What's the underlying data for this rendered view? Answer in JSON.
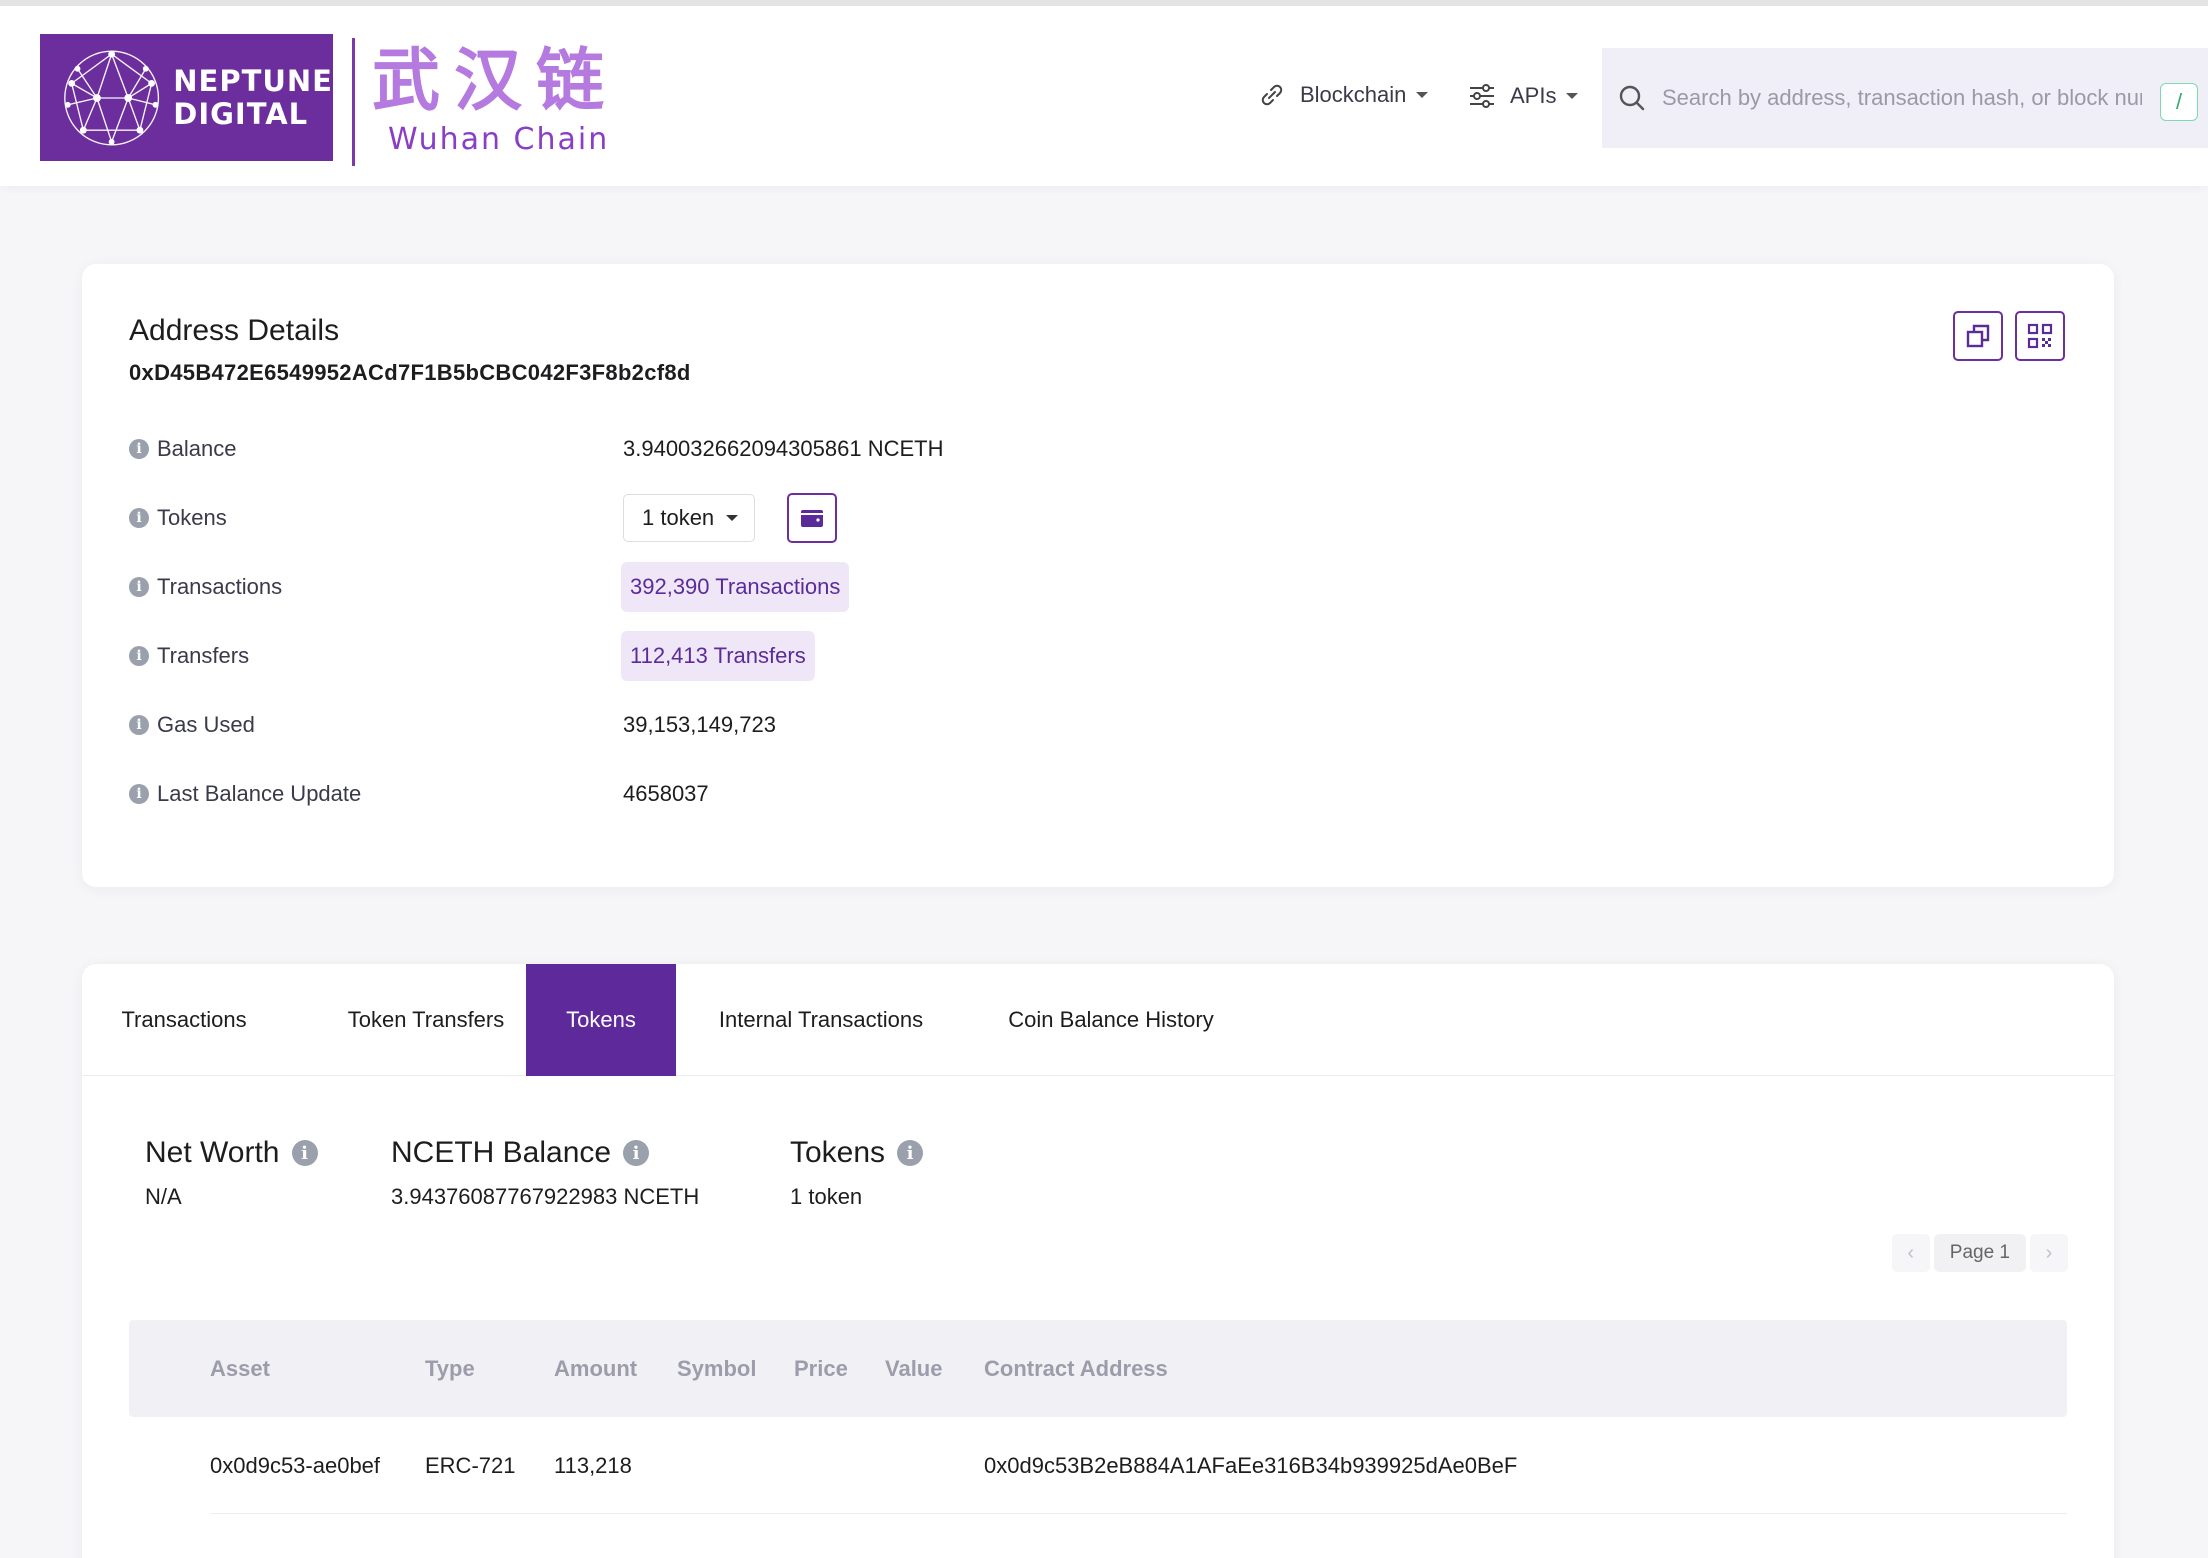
{
  "header": {
    "logo": {
      "line1": "NEPTUNE",
      "line2": "DIGITAL",
      "cn": "武汉链",
      "en": "Wuhan Chain"
    },
    "nav": [
      {
        "label": "Blockchain",
        "icon": "link-icon"
      },
      {
        "label": "APIs",
        "icon": "sliders-icon"
      }
    ],
    "search": {
      "placeholder": "Search by address, transaction hash, or block number",
      "shortcut": "/"
    }
  },
  "details": {
    "title": "Address Details",
    "address": "0xD45B472E6549952ACd7F1B5bCBC042F3F8b2cf8d",
    "rows": {
      "balance": {
        "label": "Balance",
        "value": "3.940032662094305861 NCETH"
      },
      "tokens": {
        "label": "Tokens",
        "value": "1 token"
      },
      "transactions": {
        "label": "Transactions",
        "value": "392,390 Transactions"
      },
      "transfers": {
        "label": "Transfers",
        "value": "112,413 Transfers"
      },
      "gas": {
        "label": "Gas Used",
        "value": "39,153,149,723"
      },
      "last_update": {
        "label": "Last Balance Update",
        "value": "4658037"
      }
    }
  },
  "tabs": [
    {
      "label": "Transactions",
      "active": false
    },
    {
      "label": "Token Transfers",
      "active": false
    },
    {
      "label": "Tokens",
      "active": true
    },
    {
      "label": "Internal Transactions",
      "active": false
    },
    {
      "label": "Coin Balance History",
      "active": false
    }
  ],
  "summary": {
    "net_worth": {
      "title": "Net Worth",
      "value": "N/A"
    },
    "nceth_balance": {
      "title": "NCETH Balance",
      "value": "3.94376087767922983 NCETH"
    },
    "tokens": {
      "title": "Tokens",
      "value": "1 token"
    }
  },
  "pagination": {
    "page": "Page 1"
  },
  "table": {
    "columns": [
      "Asset",
      "Type",
      "Amount",
      "Symbol",
      "Price",
      "Value",
      "Contract Address"
    ],
    "rows": [
      {
        "asset": "0x0d9c53-ae0bef",
        "type": "ERC-721",
        "amount": "113,218",
        "symbol": "",
        "price": "",
        "value": "",
        "contract": "0x0d9c53B2eB884A1AFaEe316B34b939925dAe0BeF"
      }
    ]
  },
  "colors": {
    "brand": "#6c2d9d",
    "accent": "#5e2a9b",
    "link": "#5b2c99",
    "pill_bg": "#efe7f8"
  }
}
